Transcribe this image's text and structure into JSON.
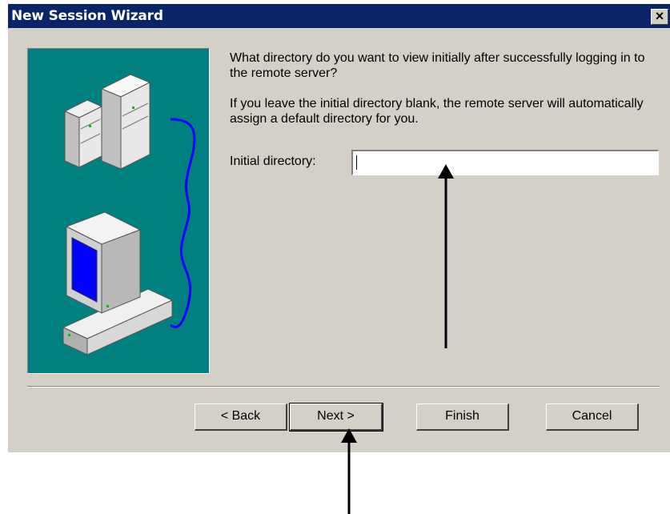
{
  "window": {
    "title": "New Session Wizard",
    "close_glyph": "×"
  },
  "content": {
    "question": "What directory do you want to view initially after successfully logging in to the remote server?",
    "info": "If you leave the initial directory blank, the remote server will automatically assign a default directory for you.",
    "field_label": "Initial directory:",
    "field_value": ""
  },
  "buttons": {
    "back": "< Back",
    "next": "Next >",
    "finish": "Finish",
    "cancel": "Cancel"
  },
  "colors": {
    "titlebar": "#0a246a",
    "dialog": "#d4d0c8",
    "illustration_bg": "#008080",
    "screen_blue": "#0000ff",
    "cable_blue": "#0000ff"
  },
  "icons": [
    "close-icon",
    "server-icon",
    "computer-icon",
    "annotation-arrow-icon"
  ]
}
